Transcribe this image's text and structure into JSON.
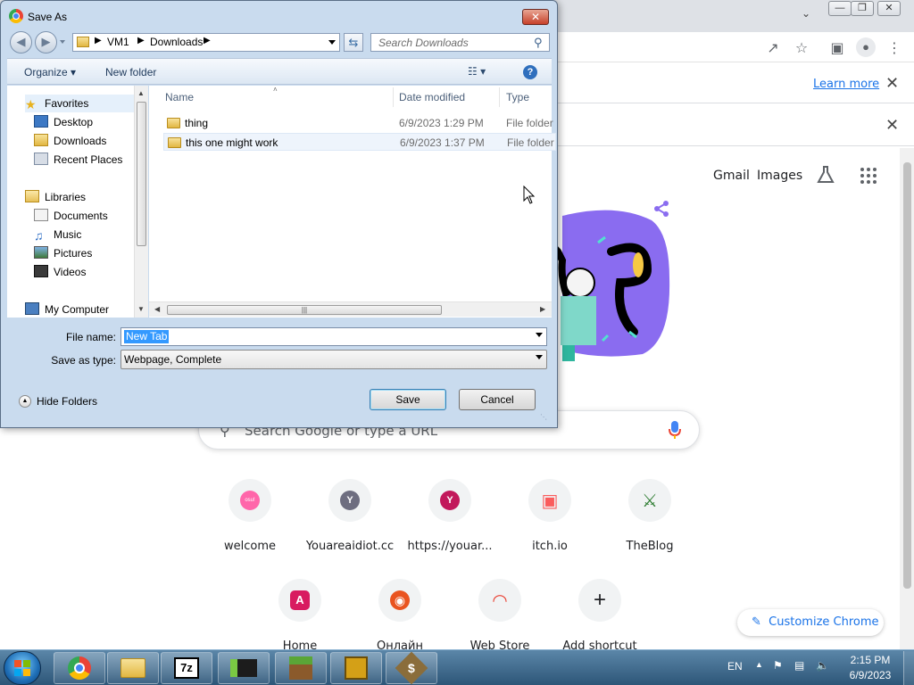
{
  "chrome": {
    "infobar": {
      "learn_more": "Learn more"
    },
    "links": {
      "gmail": "Gmail",
      "images": "Images"
    },
    "search_placeholder": "Search Google or type a URL",
    "shortcuts": [
      {
        "label": "welcome",
        "icon": "osu-icon",
        "color": "#ff66aa",
        "glyph": "osu!"
      },
      {
        "label": "Youareaidiot.cc",
        "icon": "letter-y-icon",
        "color": "#6e6e80",
        "glyph": "Y"
      },
      {
        "label": "https://youar...",
        "icon": "letter-y-icon",
        "color": "#c2185b",
        "glyph": "Y"
      },
      {
        "label": "itch.io",
        "icon": "itch-store-icon",
        "color": "#fa5c5c",
        "glyph": "▣"
      },
      {
        "label": "TheBlog",
        "icon": "sword-icon",
        "color": "#2e7d32",
        "glyph": "⚔"
      },
      {
        "label": "Home",
        "icon": "arc-a-icon",
        "color": "#d81b60",
        "glyph": "A"
      },
      {
        "label": "Онлайн",
        "icon": "ubuntu-icon",
        "color": "#e95420",
        "glyph": "◉"
      },
      {
        "label": "Web Store",
        "icon": "rainbow-icon",
        "color": "#ea4335",
        "glyph": "◠"
      },
      {
        "label": "Add shortcut",
        "icon": "plus-icon",
        "color": "#202124",
        "glyph": "+"
      }
    ],
    "customize": "Customize Chrome"
  },
  "dialog": {
    "title": "Save As",
    "breadcrumb": [
      "VM1",
      "Downloads"
    ],
    "search_placeholder": "Search Downloads",
    "toolbar": {
      "organize": "Organize ▾",
      "new_folder": "New folder"
    },
    "nav": {
      "favorites": "Favorites",
      "desktop": "Desktop",
      "downloads": "Downloads",
      "recent": "Recent Places",
      "libraries": "Libraries",
      "documents": "Documents",
      "music": "Music",
      "pictures": "Pictures",
      "videos": "Videos",
      "computer": "My Computer"
    },
    "columns": {
      "name": "Name",
      "date": "Date modified",
      "type": "Type"
    },
    "files": [
      {
        "name": "thing",
        "date": "6/9/2023 1:29 PM",
        "type": "File folder"
      },
      {
        "name": "this one might work",
        "date": "6/9/2023 1:37 PM",
        "type": "File folder"
      }
    ],
    "file_name_label": "File name:",
    "file_name_value": "New Tab",
    "save_type_label": "Save as type:",
    "save_type_value": "Webpage, Complete",
    "hide_folders": "Hide Folders",
    "save": "Save",
    "cancel": "Cancel"
  },
  "taskbar": {
    "lang": "EN",
    "time": "2:15 PM",
    "date": "6/9/2023"
  }
}
